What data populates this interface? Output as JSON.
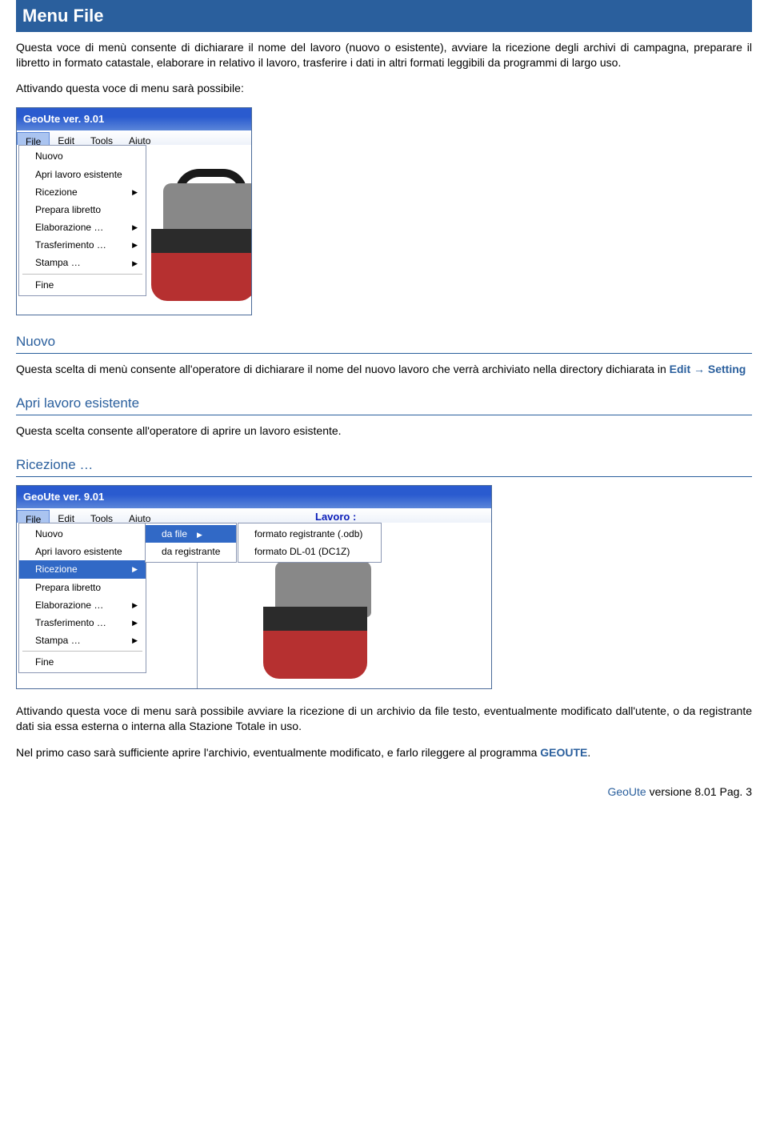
{
  "banner": "Menu File",
  "intro_para": "Questa voce di menù consente di dichiarare il nome del lavoro (nuovo o esistente), avviare la ricezione degli archivi di campagna, preparare il libretto in formato catastale, elaborare in relativo il lavoro, trasferire i dati in altri formati leggibili da programmi di largo uso.",
  "intro_para2": "Attivando questa voce di menu sarà possibile:",
  "app_title": "GeoUte ver. 9.01",
  "menubar": {
    "file": "File",
    "edit": "Edit",
    "tools": "Tools",
    "aiuto": "Aiuto"
  },
  "file_menu": {
    "nuovo": "Nuovo",
    "apri": "Apri lavoro esistente",
    "ricezione": "Ricezione",
    "prepara": "Prepara libretto",
    "elaborazione": "Elaborazione …",
    "trasferimento": "Trasferimento …",
    "stampa": "Stampa …",
    "fine": "Fine"
  },
  "lavoro_label": "Lavoro :",
  "sub_ricezione": {
    "da_file": "da file",
    "da_registrante": "da registrante"
  },
  "sub_da_file": {
    "odb": "formato registrante (.odb)",
    "dl01": "formato DL-01 (DC1Z)"
  },
  "section_nuovo_title": "Nuovo",
  "section_nuovo_text_pre": "Questa scelta di menù consente all'operatore di dichiarare il nome del nuovo lavoro che verrà archiviato nella directory dichiarata in ",
  "section_nuovo_text_link": "Edit → Setting",
  "section_apri_title": "Apri lavoro esistente",
  "section_apri_text": "Questa scelta consente all'operatore di aprire un lavoro esistente.",
  "section_ricezione_title": "Ricezione …",
  "ricezione_para1": "Attivando questa voce di menu sarà possibile avviare la ricezione di un archivio da file testo, eventualmente modificato dall'utente, o da registrante dati sia essa esterna o interna alla Stazione Totale in uso.",
  "ricezione_para2_pre": "Nel primo caso sarà sufficiente aprire l'archivio, eventualmente modificato, e farlo rileggere al programma ",
  "ricezione_para2_link": "GEOUTE",
  "ricezione_para2_post": ".",
  "footer_product": "GeoUte",
  "footer_rest": " versione 8.01 Pag. 3"
}
